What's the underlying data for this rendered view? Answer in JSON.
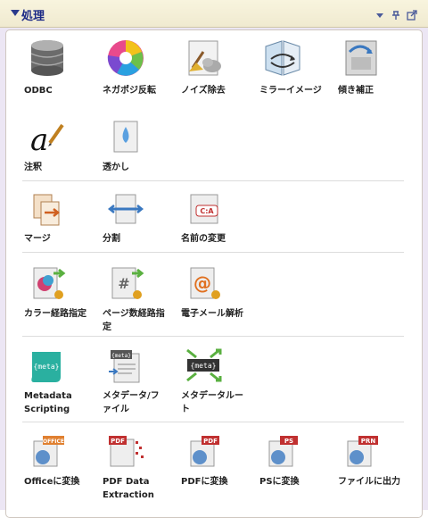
{
  "panel": {
    "title": "処理",
    "controls": [
      "dropdown-icon",
      "pin-icon",
      "popout-icon"
    ]
  },
  "groups": [
    {
      "tools": [
        {
          "label": "ODBC",
          "icon": "database-icon"
        },
        {
          "label": "ネガポジ反転",
          "icon": "color-wheel-icon"
        },
        {
          "label": "ノイズ除去",
          "icon": "broom-cleanup-icon"
        },
        {
          "label": "ミラーイメージ",
          "icon": "mirror-icon"
        },
        {
          "label": "傾き補正",
          "icon": "deskew-icon"
        },
        {
          "label": "注釈",
          "icon": "annotation-icon"
        },
        {
          "label": "透かし",
          "icon": "watermark-drop-icon"
        }
      ]
    },
    {
      "tools": [
        {
          "label": "マージ",
          "icon": "merge-icon"
        },
        {
          "label": "分割",
          "icon": "split-icon"
        },
        {
          "label": "名前の変更",
          "icon": "rename-icon"
        }
      ]
    },
    {
      "tools": [
        {
          "label": "カラー経路指定",
          "icon": "color-routing-icon"
        },
        {
          "label": "ページ数経路指定",
          "icon": "page-count-routing-icon"
        },
        {
          "label": "電子メール解析",
          "icon": "email-parse-icon"
        }
      ]
    },
    {
      "tools": [
        {
          "label": "Metadata Scripting",
          "icon": "metadata-scripting-icon"
        },
        {
          "label": "メタデータ/ファイル",
          "icon": "metadata-file-icon"
        },
        {
          "label": "メタデータルート",
          "icon": "metadata-route-icon"
        }
      ]
    },
    {
      "tools": [
        {
          "label": "Officeに変換",
          "icon": "office-convert-icon"
        },
        {
          "label": "PDF Data Extraction",
          "icon": "pdf-extract-icon"
        },
        {
          "label": "PDFに変換",
          "icon": "pdf-convert-icon"
        },
        {
          "label": "PSに変換",
          "icon": "ps-convert-icon"
        },
        {
          "label": "ファイルに出力",
          "icon": "prn-output-icon"
        }
      ]
    }
  ],
  "badges": {
    "pdf_extract": "PDF",
    "pdf": "PDF",
    "ps": "PS",
    "prn": "PRN",
    "office": "OFFICE",
    "meta": "{meta}",
    "rename": "C:A"
  }
}
